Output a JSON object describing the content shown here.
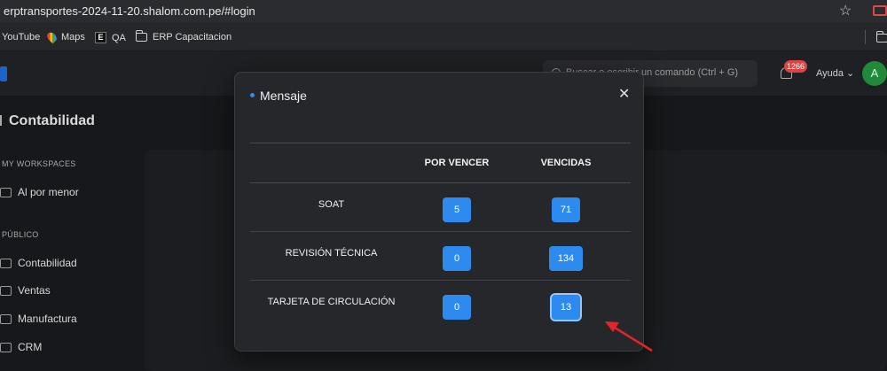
{
  "browser": {
    "url": "erptransportes-2024-11-20.shalom.com.pe/#login",
    "bookmarks": [
      {
        "label": "YouTube",
        "icon": "youtube-icon"
      },
      {
        "label": "Maps",
        "icon": "maps-pin-icon"
      },
      {
        "label": "QA",
        "icon": "e-icon"
      },
      {
        "label": "ERP Capacitacion",
        "icon": "folder-icon"
      }
    ]
  },
  "header": {
    "command_placeholder": "Buscar o escribir un comando (Ctrl + G)",
    "notification_count": "1266",
    "help_label": "Ayuda",
    "avatar_initial": "A"
  },
  "sidebar": {
    "title": "Contabilidad",
    "sections": [
      {
        "label": "MY WORKSPACES",
        "items": [
          "Al por menor"
        ]
      },
      {
        "label": "PÚBLICO",
        "items": [
          "Contabilidad",
          "Ventas",
          "Manufactura",
          "CRM"
        ]
      }
    ]
  },
  "modal": {
    "title": "Mensaje",
    "columns": [
      "",
      "POR VENCER",
      "VENCIDAS"
    ],
    "rows": [
      {
        "label": "SOAT",
        "por_vencer": "5",
        "vencidas": "71"
      },
      {
        "label": "REVISIÓN TÉCNICA",
        "por_vencer": "0",
        "vencidas": "134"
      },
      {
        "label": "TARJETA DE CIRCULACIÓN",
        "por_vencer": "0",
        "vencidas": "13"
      }
    ]
  },
  "colors": {
    "accent_blue": "#2d8bf0",
    "annotation_arrow": "#e0262a",
    "badge_red": "#d94545",
    "avatar_green": "#1e8a3a"
  }
}
